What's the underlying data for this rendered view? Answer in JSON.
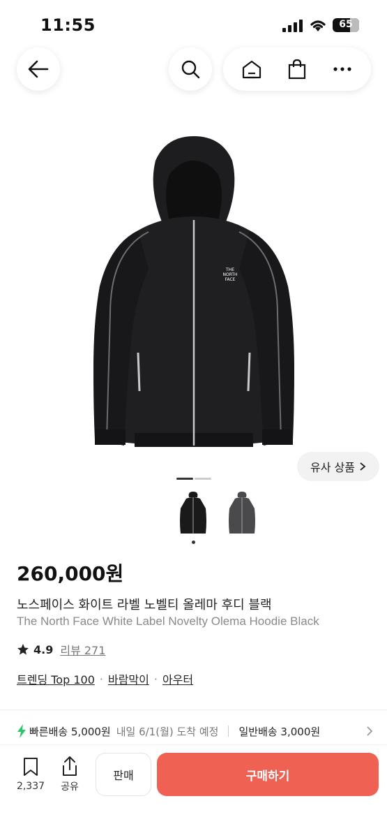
{
  "status": {
    "time": "11:55",
    "battery": "65",
    "battery_level": 0.65
  },
  "nav": {
    "back_icon": "arrow-left-icon",
    "search_icon": "search-icon",
    "home_icon": "home-icon",
    "bag_icon": "shopping-bag-icon",
    "more_icon": "more-horizontal-icon"
  },
  "gallery": {
    "similar_label": "유사 상품",
    "current_page": 1,
    "total_pages": 2
  },
  "product": {
    "price": "260,000원",
    "title_ko": "노스페이스 화이트 라벨 노벨티 올레마 후디 블랙",
    "title_en": "The North Face White Label Novelty Olema Hoodie Black",
    "rating": "4.9",
    "reviews": "리뷰 271",
    "tags": [
      "트렌딩 Top 100",
      "바람막이",
      "아우터"
    ],
    "logo_text": "THE NORTH FACE"
  },
  "shipping": {
    "fast_label": "빠른배송 5,000원",
    "fast_date": "내일 6/1(월) 도착 예정",
    "normal_label": "일반배송 3,000원"
  },
  "actions": {
    "fav_count": "2,337",
    "share_label": "공유",
    "sell_label": "판매",
    "buy_label": "구매하기"
  },
  "colors": {
    "accent": "#ef6253",
    "fast_icon": "#2fc66b"
  }
}
